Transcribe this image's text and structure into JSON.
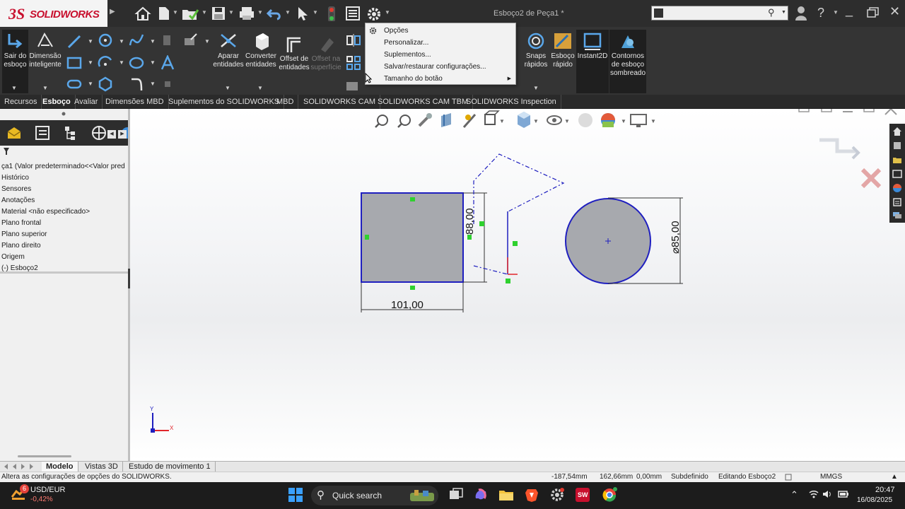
{
  "app": {
    "logo_ds": "3S",
    "logo_text": "SOLIDWORKS",
    "document_title": "Esboço2 de Peça1 *",
    "search_placeholder": ""
  },
  "ribbon": {
    "sair_label": "Sair do esboço",
    "dimensao_label": "Dimensão inteligente",
    "aparar_label": "Aparar entidades",
    "converter_label": "Converter entidades",
    "offset_entidades_label": "Offset de entidades",
    "offset_superficie_label": "Offset na superfície",
    "snaps_label": "Snaps rápidos",
    "esboco_rapido_label": "Esboço rápido",
    "instant2d_label": "Instant2D",
    "contornos_label": "Contornos de esboço sombreado"
  },
  "options_menu": {
    "items": [
      {
        "label": "Opções"
      },
      {
        "label": "Personalizar..."
      },
      {
        "label": "Suplementos..."
      },
      {
        "label": "Salvar/restaurar configurações..."
      },
      {
        "label": "Tamanho do botão"
      }
    ]
  },
  "tabs": [
    {
      "label": "Recursos"
    },
    {
      "label": "Esboço"
    },
    {
      "label": "Avaliar"
    },
    {
      "label": "Dimensões MBD"
    },
    {
      "label": "Suplementos do SOLIDWORKS"
    },
    {
      "label": "MBD"
    },
    {
      "label": "SOLIDWORKS CAM"
    },
    {
      "label": "SOLIDWORKS CAM TBM"
    },
    {
      "label": "SOLIDWORKS Inspection"
    }
  ],
  "tree": {
    "items": [
      {
        "label": "ça1  (Valor predeterminado<<Valor pred"
      },
      {
        "label": "Histórico"
      },
      {
        "label": "Sensores"
      },
      {
        "label": "Anotações"
      },
      {
        "label": "Material <não especificado>"
      },
      {
        "label": "Plano frontal"
      },
      {
        "label": "Plano superior"
      },
      {
        "label": "Plano direito"
      },
      {
        "label": "Origem"
      },
      {
        "label": "(-) Esboço2"
      }
    ]
  },
  "sketch": {
    "rect_width": "101,00",
    "rect_height": "88,00",
    "circle_diameter": "⌀85,00",
    "axis_y": "Y",
    "axis_x": "X"
  },
  "bottom_tabs": [
    {
      "label": "Modelo"
    },
    {
      "label": "Vistas 3D"
    },
    {
      "label": "Estudo de movimento 1"
    }
  ],
  "status": {
    "message": "Altera as configurações de opções do SOLIDWORKS.",
    "x": "-187,54mm",
    "y": "162,66mm",
    "z": "0,00mm",
    "state": "Subdefinido",
    "editing": "Editando Esboço2",
    "units": "MMGS"
  },
  "taskbar": {
    "fx_badge": "6",
    "fx_pair": "USD/EUR",
    "fx_change": "-0,42%",
    "search_label": "Quick search",
    "time": "20:47",
    "date": "16/08/2025"
  },
  "colors": {
    "sketch_blue": "#1f1fbf",
    "fill_gray": "#a7a9ae",
    "relation_green": "#2fd12f",
    "tab_bg": "#2a2a2a",
    "ribbon_bg": "#343434"
  }
}
